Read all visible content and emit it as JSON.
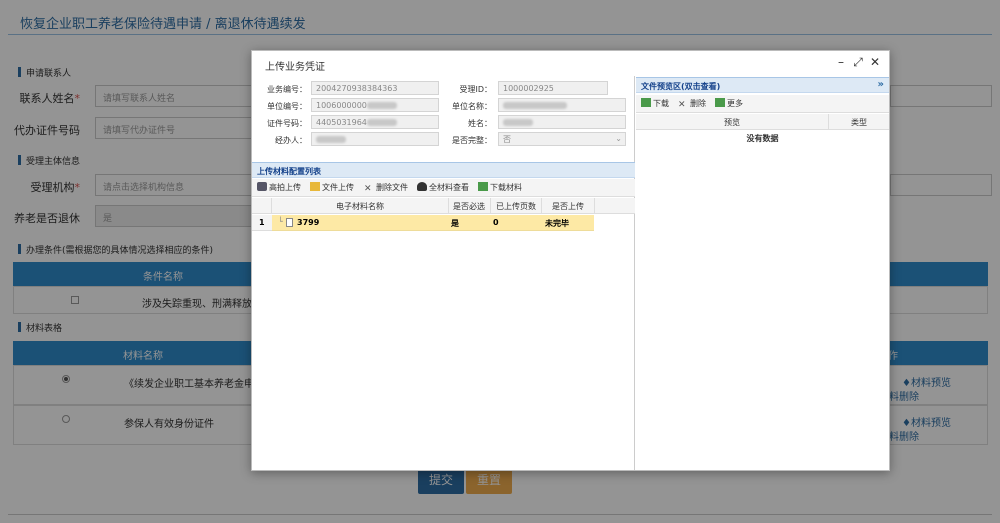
{
  "page": {
    "title": "恢复企业职工养老保险待遇申请 / 离退休待遇续发",
    "sections": {
      "contact": "申请联系人",
      "subject": "受理主体信息",
      "conditions": "办理条件(需根据您的具体情况选择相应的条件)",
      "materials": "材料表格"
    },
    "fields": {
      "contact_name_label": "联系人姓名",
      "contact_name_placeholder": "请填写联系人姓名",
      "agent_id_label": "代办证件号码",
      "agent_id_placeholder": "请填写代办证件号",
      "agency_label": "受理机构",
      "agency_placeholder": "请点击选择机构信息",
      "retired_label": "养老是否退休",
      "retired_value": "是",
      "required_mark": "*"
    },
    "conditions_table": {
      "header": "条件名称",
      "row1": "涉及失踪重现、刑满释放"
    },
    "materials_table": {
      "header_name": "材料名称",
      "header_op": "作",
      "row1_name": "《续发企业职工基本养老金申",
      "row2_name": "参保人有效身份证件",
      "preview": "材料预览",
      "delete": "料删除"
    },
    "buttons": {
      "submit": "提交",
      "reset": "重置"
    }
  },
  "modal": {
    "title": "上传业务凭证",
    "controls": {
      "minimize": "–",
      "maximize": "⤢",
      "close": "✕"
    },
    "form": {
      "biz_no_label": "业务编号：",
      "biz_no_value": "2004270938384363",
      "accept_id_label": "受理ID：",
      "accept_id_value": "1000002925",
      "unit_no_label": "单位编号：",
      "unit_no_value": "1006000000",
      "unit_name_label": "单位名称：",
      "unit_name_value": "",
      "cert_no_label": "证件号码：",
      "cert_no_value": "4405031964",
      "name_label": "姓名：",
      "name_value": "",
      "handler_label": "经办人：",
      "handler_value": "",
      "complete_label": "是否完整：",
      "complete_value": "否"
    },
    "upload_panel": {
      "title": "上传材料配置列表",
      "toolbar": [
        "高拍上传",
        "文件上传",
        "删除文件",
        "全材料查看",
        "下载材料"
      ],
      "columns": [
        "电子材料名称",
        "是否必选",
        "已上传页数",
        "是否上传"
      ],
      "rows": [
        {
          "index": "1",
          "name": "3799",
          "required": "是",
          "pages": "0",
          "uploaded": "未完毕"
        }
      ]
    },
    "preview_panel": {
      "title": "文件预览区(双击查看)",
      "expand": "»",
      "toolbar": [
        "下载",
        "删除",
        "更多"
      ],
      "columns": [
        "预览",
        "类型"
      ],
      "empty": "没有数据"
    }
  },
  "colors": {
    "accent": "#2f8ccc",
    "title_blue": "#2e6da4",
    "submit": "#2e6da4",
    "reset": "#f0ad4e",
    "row_highlight": "#fde9a5"
  }
}
